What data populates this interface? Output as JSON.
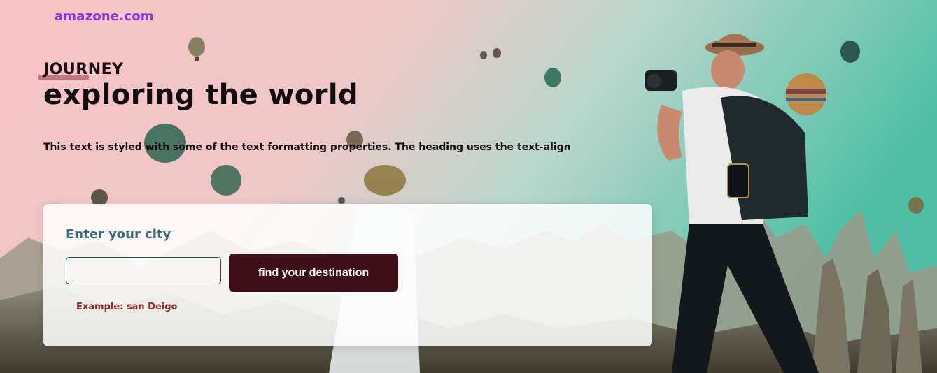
{
  "header": {
    "brand": "amazone.com"
  },
  "hero": {
    "kicker": "JOURNEY",
    "headline": "exploring the world",
    "description": "This text is styled with some of the text formatting properties. The heading uses the text-align"
  },
  "search_card": {
    "label": "Enter your city",
    "input_value": "",
    "input_placeholder": "",
    "button_label": "find your destination",
    "example": "Example: san Deigo"
  },
  "colors": {
    "brand": "#8a35e0",
    "button": "#3e0f19",
    "label": "#3c6a80",
    "example": "#8a2c22"
  },
  "background_image": {
    "description_icon": "hot-air-balloons-photo"
  }
}
